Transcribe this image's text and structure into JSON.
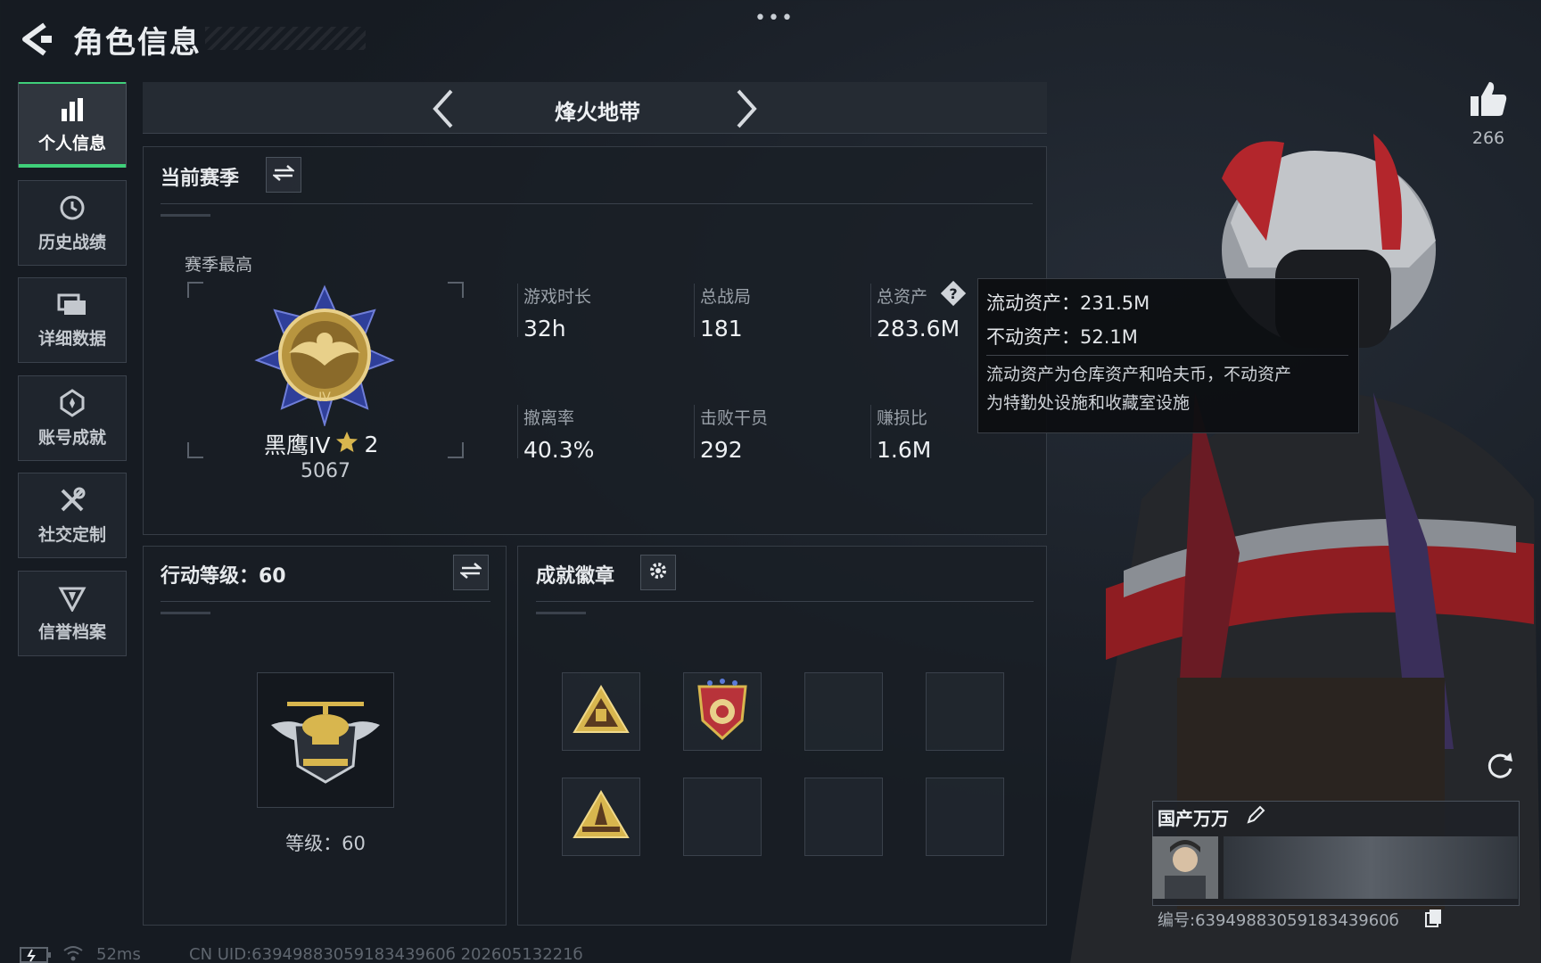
{
  "header": {
    "title": "角色信息",
    "more_label": "•••"
  },
  "sidebar": {
    "items": [
      {
        "label": "个人信息",
        "icon": "bar-chart-icon",
        "active": true
      },
      {
        "label": "历史战绩",
        "icon": "history-icon",
        "active": false
      },
      {
        "label": "详细数据",
        "icon": "folder-icon",
        "active": false
      },
      {
        "label": "账号成就",
        "icon": "medal-icon",
        "active": false
      },
      {
        "label": "社交定制",
        "icon": "tools-icon",
        "active": false
      },
      {
        "label": "信誉档案",
        "icon": "shield-icon",
        "active": false
      }
    ]
  },
  "mode": {
    "title": "烽火地带"
  },
  "season": {
    "title": "当前赛季",
    "best_label": "赛季最高",
    "rank_name": "黑鹰IV",
    "rank_stars": "2",
    "rank_score": "5067",
    "stats": [
      {
        "label": "游戏时长",
        "value": "32h"
      },
      {
        "label": "总战局",
        "value": "181"
      },
      {
        "label": "总资产",
        "value": "283.6M"
      },
      {
        "label": "撤离率",
        "value": "40.3%"
      },
      {
        "label": "击败干员",
        "value": "292"
      },
      {
        "label": "赚损比",
        "value": "1.6M"
      }
    ]
  },
  "tooltip": {
    "liquid": "流动资产：231.5M",
    "fixed": "不动资产：52.1M",
    "desc_line1": "流动资产为仓库资产和哈夫币，不动资产",
    "desc_line2": "为特勤处设施和收藏室设施"
  },
  "action_level": {
    "title": "行动等级：60",
    "level_text": "等级：60"
  },
  "achievements": {
    "title": "成就徽章"
  },
  "likes": {
    "count": "266"
  },
  "player": {
    "name": "国产万万",
    "id_text": "编号:6394988305918343960б"
  },
  "footer": {
    "ping": "52ms",
    "uid_text": "CN UID:6394988305918343960б 20260513221б"
  },
  "colors": {
    "accent_green": "#3fd07a",
    "background": "#161b22",
    "panel": "#1a1f26"
  }
}
